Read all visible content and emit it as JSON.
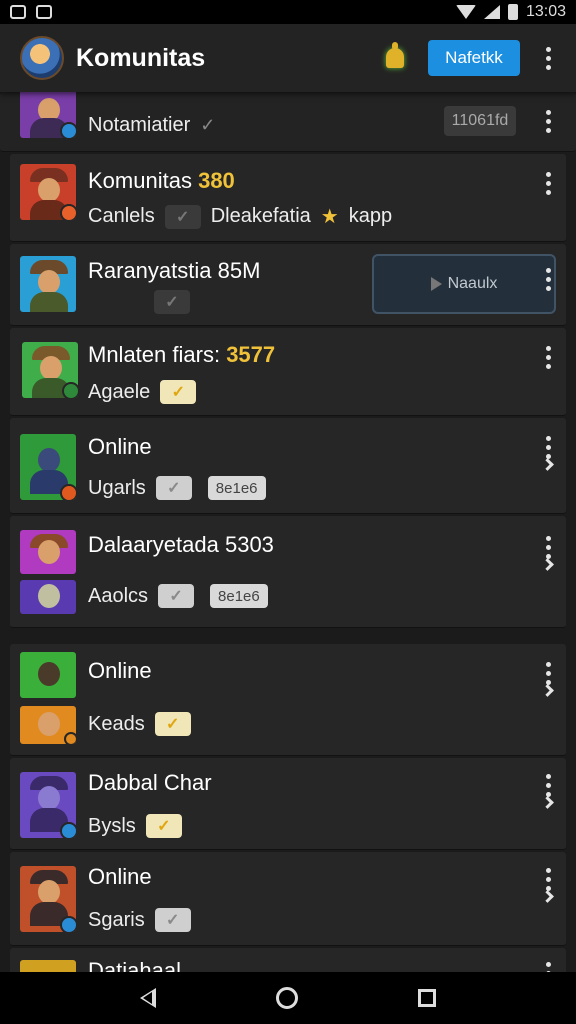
{
  "status_bar": {
    "time": "13:03"
  },
  "header": {
    "title": "Komunitas",
    "action_label": "Nafetkk"
  },
  "rows": [
    {
      "title": "Notamiatier",
      "pill": "11061fd",
      "thumb_colors": [
        "#7a3ea8",
        "#3d2a55",
        "#2b8cd6"
      ],
      "has_pill": true
    },
    {
      "title": "Komunitas",
      "title_num": "380",
      "subtitle": "Canlels",
      "subtitle2": "Dleakefatia",
      "subtitle3": "kapp",
      "chip": "✓",
      "thumb_colors": [
        "#c8402a",
        "#7a3020",
        "#e8602a"
      ]
    },
    {
      "title": "Raranyatstia 85M",
      "button_label": "Naaulx",
      "chip": "✓",
      "thumb_colors": [
        "#2a9fd6",
        "#6a4a2a",
        "#3b7fc4"
      ]
    },
    {
      "title": "Mnlaten fiars:",
      "title_num": "3577",
      "subtitle": "Agaele",
      "chip": "✓",
      "thumb_colors": [
        "#3fae4a",
        "#7a5a2a",
        "#2e8a3a"
      ]
    },
    {
      "title": "Online",
      "subtitle": "Ugarls",
      "tag": "8e1e6",
      "chip": "✓",
      "thumb_colors": [
        "#2f9a3a",
        "#2a3a6a",
        "#e05a20"
      ]
    },
    {
      "title": "Dalaaryetada 5303",
      "subtitle": "Aaolcs",
      "tag": "8e1e6",
      "chip": "✓",
      "thumb_colors": [
        "#b03ac0",
        "#8a4a2a",
        "#5a3ab0"
      ]
    },
    {
      "title": "Online",
      "subtitle": "Keads",
      "chip": "✓",
      "thumb_colors": [
        "#3ab03a",
        "#4a3a2a",
        "#e08a20"
      ]
    },
    {
      "title": "Dabbal Char",
      "subtitle": "Bysls",
      "chip": "✓",
      "thumb_colors": [
        "#6a4ac0",
        "#3a2a6a",
        "#2b8cd6"
      ]
    },
    {
      "title": "Online",
      "subtitle": "Sgaris",
      "chip": "✓",
      "thumb_colors": [
        "#c0502a",
        "#3a2a2a",
        "#2b8cd6"
      ]
    },
    {
      "title": "Datiahaal",
      "thumb_colors": [
        "#d0a020",
        "#8a2a2a",
        "#2b8cd6"
      ]
    }
  ]
}
